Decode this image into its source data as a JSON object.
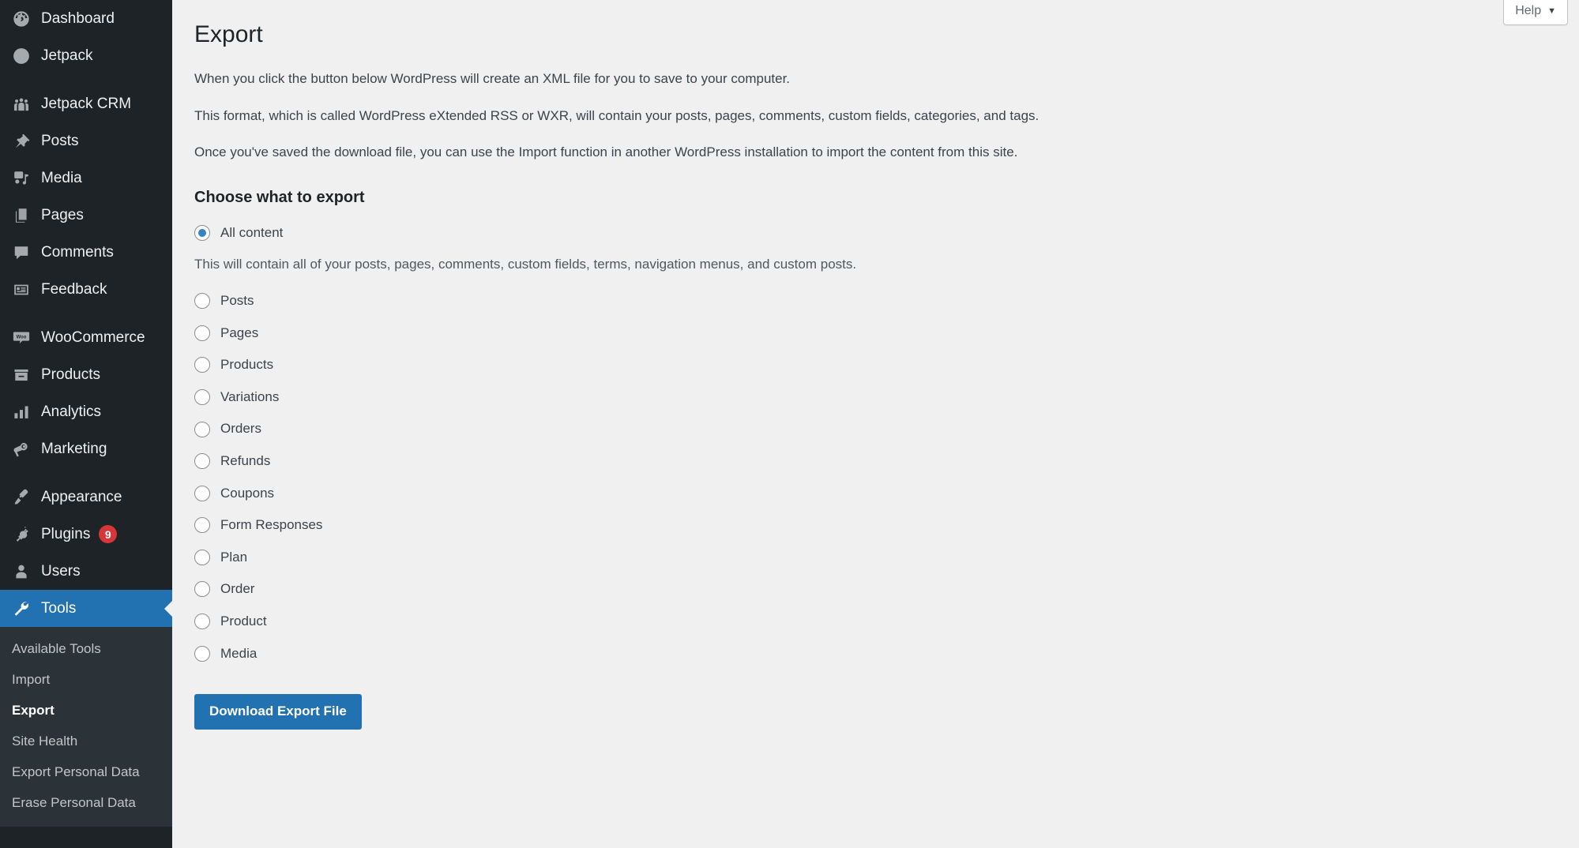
{
  "sidebar": {
    "groups": [
      {
        "items": [
          {
            "label": "Dashboard",
            "icon": "dashboard-icon",
            "name": "sidebar-item-dashboard"
          },
          {
            "label": "Jetpack",
            "icon": "jetpack-icon",
            "name": "sidebar-item-jetpack"
          }
        ]
      },
      {
        "items": [
          {
            "label": "Jetpack CRM",
            "icon": "groups-icon",
            "name": "sidebar-item-jetpack-crm"
          },
          {
            "label": "Posts",
            "icon": "pin-icon",
            "name": "sidebar-item-posts"
          },
          {
            "label": "Media",
            "icon": "media-icon",
            "name": "sidebar-item-media"
          },
          {
            "label": "Pages",
            "icon": "pages-icon",
            "name": "sidebar-item-pages"
          },
          {
            "label": "Comments",
            "icon": "comment-icon",
            "name": "sidebar-item-comments"
          },
          {
            "label": "Feedback",
            "icon": "feedback-icon",
            "name": "sidebar-item-feedback"
          }
        ]
      },
      {
        "items": [
          {
            "label": "WooCommerce",
            "icon": "woocommerce-icon",
            "name": "sidebar-item-woocommerce"
          },
          {
            "label": "Products",
            "icon": "products-icon",
            "name": "sidebar-item-products"
          },
          {
            "label": "Analytics",
            "icon": "analytics-icon",
            "name": "sidebar-item-analytics"
          },
          {
            "label": "Marketing",
            "icon": "megaphone-icon",
            "name": "sidebar-item-marketing"
          }
        ]
      },
      {
        "items": [
          {
            "label": "Appearance",
            "icon": "paintbrush-icon",
            "name": "sidebar-item-appearance"
          },
          {
            "label": "Plugins",
            "icon": "plugin-icon",
            "name": "sidebar-item-plugins",
            "badge": "9"
          },
          {
            "label": "Users",
            "icon": "user-icon",
            "name": "sidebar-item-users"
          },
          {
            "label": "Tools",
            "icon": "wrench-icon",
            "name": "sidebar-item-tools",
            "current": true
          }
        ]
      }
    ],
    "submenu": [
      {
        "label": "Available Tools",
        "name": "submenu-item-available-tools"
      },
      {
        "label": "Import",
        "name": "submenu-item-import"
      },
      {
        "label": "Export",
        "name": "submenu-item-export",
        "current": true
      },
      {
        "label": "Site Health",
        "name": "submenu-item-site-health"
      },
      {
        "label": "Export Personal Data",
        "name": "submenu-item-export-personal-data"
      },
      {
        "label": "Erase Personal Data",
        "name": "submenu-item-erase-personal-data"
      }
    ]
  },
  "screen_meta": {
    "help_label": "Help",
    "help_caret": "▼"
  },
  "main": {
    "title": "Export",
    "paragraphs": [
      "When you click the button below WordPress will create an XML file for you to save to your computer.",
      "This format, which is called WordPress eXtended RSS or WXR, will contain your posts, pages, comments, custom fields, categories, and tags.",
      "Once you've saved the download file, you can use the Import function in another WordPress installation to import the content from this site."
    ],
    "section_title": "Choose what to export",
    "all_content": {
      "label": "All content",
      "checked": true,
      "description": "This will contain all of your posts, pages, comments, custom fields, terms, navigation menus, and custom posts."
    },
    "options": [
      {
        "label": "Posts",
        "name": "radio-posts"
      },
      {
        "label": "Pages",
        "name": "radio-pages"
      },
      {
        "label": "Products",
        "name": "radio-products"
      },
      {
        "label": "Variations",
        "name": "radio-variations"
      },
      {
        "label": "Orders",
        "name": "radio-orders"
      },
      {
        "label": "Refunds",
        "name": "radio-refunds"
      },
      {
        "label": "Coupons",
        "name": "radio-coupons"
      },
      {
        "label": "Form Responses",
        "name": "radio-form-responses"
      },
      {
        "label": "Plan",
        "name": "radio-plan"
      },
      {
        "label": "Order",
        "name": "radio-order"
      },
      {
        "label": "Product",
        "name": "radio-product"
      },
      {
        "label": "Media",
        "name": "radio-media"
      }
    ],
    "submit_label": "Download Export File"
  },
  "colors": {
    "sidebar_bg": "#1d2327",
    "submenu_bg": "#2c3338",
    "accent_blue": "#2271b1",
    "radio_dot": "#3582c4",
    "badge_red": "#d63638",
    "content_bg": "#f0f0f1"
  }
}
